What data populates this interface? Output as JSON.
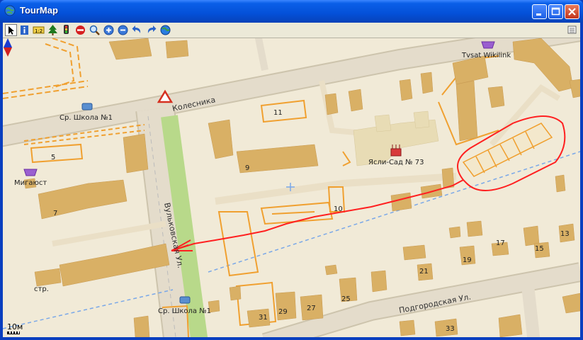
{
  "window": {
    "title": "TourMap"
  },
  "toolbar": {
    "tools": [
      "pointer-tool",
      "info-tool",
      "scale-tool",
      "tree-tool",
      "traffic-light-tool",
      "stop-tool",
      "search-tool",
      "zoom-in-tool",
      "zoom-out-tool",
      "undo-tool",
      "redo-tool",
      "globe-tool"
    ]
  },
  "map": {
    "streets": {
      "kolesnika": "Колесника",
      "vulkovskaya": "Вульковская Ул.",
      "podgorodskaya": "Подгородская Ул."
    },
    "pois": {
      "school_top": "Ср. Школа №1",
      "school_bottom": "Ср. Школа №1",
      "migayust": "Мигаюст",
      "tvsat": "Tvsat Wikilink",
      "kindergarten": "Ясли-Сад № 73",
      "str": "стр."
    },
    "house_numbers": {
      "n5": "5",
      "n7": "7",
      "n9": "9",
      "n10": "10",
      "n11": "11",
      "n13": "13",
      "n15": "15",
      "n17": "17",
      "n19": "19",
      "n21": "21",
      "n25": "25",
      "n27": "27",
      "n29": "29",
      "n31": "31",
      "n33": "33"
    },
    "scale": "10м",
    "colors": {
      "route": "#ff2020",
      "building": "#d9b065",
      "outline": "#f0a030",
      "road": "#e4dccb",
      "park": "#b8d98a"
    }
  }
}
